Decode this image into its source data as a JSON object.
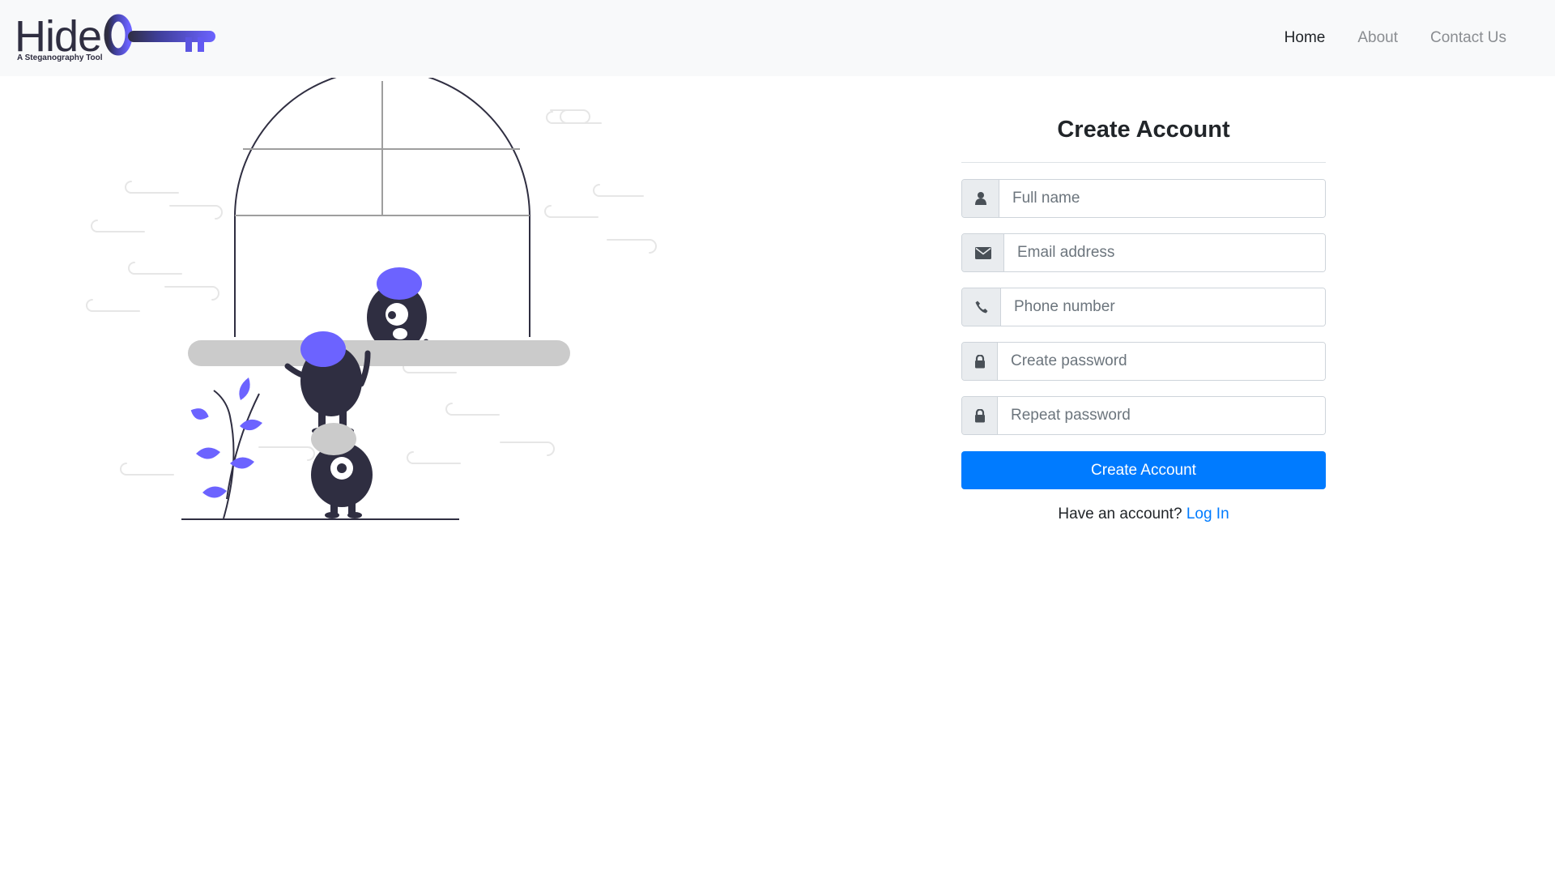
{
  "brand": {
    "name": "Hide",
    "tagline": "A Steganography Tool",
    "logo_icon": "key-icon",
    "accent_color": "#5b5bd6"
  },
  "nav": {
    "items": [
      {
        "label": "Home",
        "active": true
      },
      {
        "label": "About",
        "active": false
      },
      {
        "label": "Contact Us",
        "active": false
      }
    ]
  },
  "form": {
    "title": "Create Account",
    "fields": [
      {
        "icon": "user-icon",
        "placeholder": "Full name",
        "value": ""
      },
      {
        "icon": "envelope-icon",
        "placeholder": "Email address",
        "value": ""
      },
      {
        "icon": "phone-icon",
        "placeholder": "Phone number",
        "value": ""
      },
      {
        "icon": "lock-icon",
        "placeholder": "Create password",
        "value": ""
      },
      {
        "icon": "lock-icon",
        "placeholder": "Repeat password",
        "value": ""
      }
    ],
    "submit_label": "Create Account",
    "login_prompt": "Have an account?",
    "login_link": "Log In"
  },
  "colors": {
    "primary": "#007bff",
    "illustration_accent": "#6c63ff",
    "illustration_dark": "#2f2e41",
    "illustration_gray": "#cbcbcb"
  }
}
